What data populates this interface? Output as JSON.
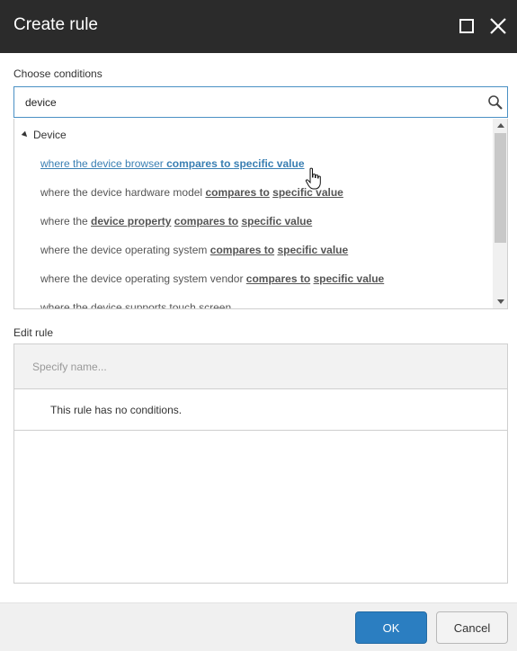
{
  "window": {
    "title": "Create rule"
  },
  "conditions": {
    "label": "Choose conditions",
    "search_value": "device",
    "group_name": "Device",
    "items": [
      {
        "prefix": "where the device browser ",
        "parts": [
          "compares to",
          " ",
          "specific value"
        ]
      },
      {
        "prefix": "where the device hardware model ",
        "parts": [
          "compares to",
          " ",
          "specific value"
        ]
      },
      {
        "prefix": "where the ",
        "parts": [
          "device property",
          " ",
          "compares to",
          " ",
          "specific value"
        ]
      },
      {
        "prefix": "where the device operating system ",
        "parts": [
          "compares to",
          " ",
          "specific value"
        ]
      },
      {
        "prefix": "where the device operating system vendor ",
        "parts": [
          "compares to",
          " ",
          "specific value"
        ]
      },
      {
        "prefix": "where the device supports touch screen",
        "parts": []
      }
    ]
  },
  "edit_rule": {
    "label": "Edit rule",
    "name_placeholder": "Specify name...",
    "empty_message": "This rule has no conditions."
  },
  "footer": {
    "ok_label": "OK",
    "cancel_label": "Cancel"
  },
  "colors": {
    "titlebar": "#2b2b2b",
    "accent": "#2b7ec1",
    "link_hover": "#3a7fb3"
  }
}
